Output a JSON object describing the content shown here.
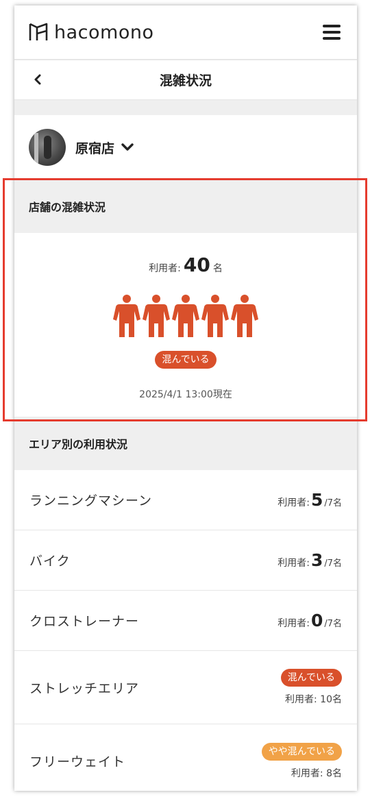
{
  "header": {
    "logo_text": "hacomono",
    "menu_icon": "hamburger-icon"
  },
  "title_bar": {
    "title": "混雑状況",
    "back_icon": "chevron-left-icon"
  },
  "store": {
    "name": "原宿店",
    "dropdown_icon": "chevron-down-icon"
  },
  "store_status": {
    "section_title": "店舗の混雑状況",
    "users_label": "利用者:",
    "users_count": "40",
    "users_unit": "名",
    "person_icon_count": 5,
    "status_badge": "混んでいる",
    "timestamp": "2025/4/1 13:00現在",
    "accent_color": "#d9502b"
  },
  "area_section": {
    "title": "エリア別の利用状況",
    "areas": [
      {
        "name": "ランニングマシーン",
        "label": "利用者:",
        "count": "5",
        "cap": "/7名"
      },
      {
        "name": "バイク",
        "label": "利用者:",
        "count": "3",
        "cap": "/7名"
      },
      {
        "name": "クロストレーナー",
        "label": "利用者:",
        "count": "0",
        "cap": "/7名"
      },
      {
        "name": "ストレッチエリア",
        "badge": "混んでいる",
        "badge_color": "#d9502b",
        "count_text": "利用者: 10名"
      },
      {
        "name": "フリーウェイト",
        "badge": "やや混んでいる",
        "badge_color": "#f1a247",
        "count_text": "利用者: 8名"
      }
    ]
  }
}
